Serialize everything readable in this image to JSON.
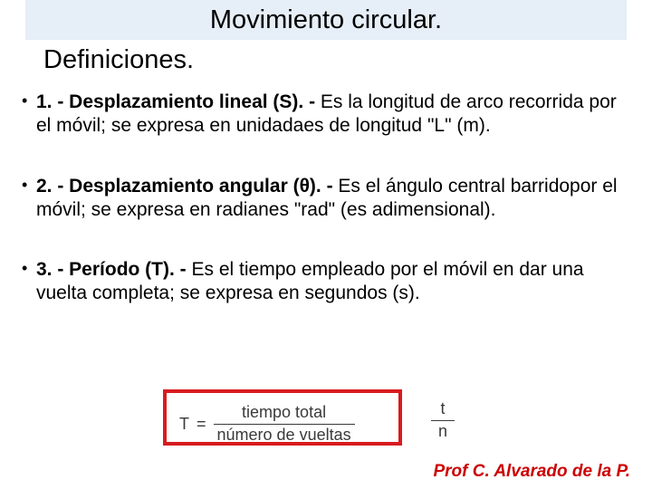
{
  "title": "Movimiento circular.",
  "subtitle": "Definiciones.",
  "bullets": [
    {
      "lead": "1. - Desplazamiento lineal (S). - ",
      "rest": "Es la longitud de arco recorrida por el móvil; se expresa en unidadaes de longitud \"L\" (m)."
    },
    {
      "lead": "2. - Desplazamiento angular (θ). - ",
      "rest": "Es el ángulo central barridopor el móvil; se expresa en radianes \"rad\" (es adimensional)."
    },
    {
      "lead": "3. - Período (T). - ",
      "rest": "Es el tiempo empleado por el móvil en dar una vuelta completa; se expresa en segundos (s)."
    }
  ],
  "formula": {
    "lhs": "T",
    "eq": "=",
    "num": "tiempo total",
    "den": "número de vueltas",
    "short_num": "t",
    "short_den": "n"
  },
  "footer": "Prof C. Alvarado de la P."
}
